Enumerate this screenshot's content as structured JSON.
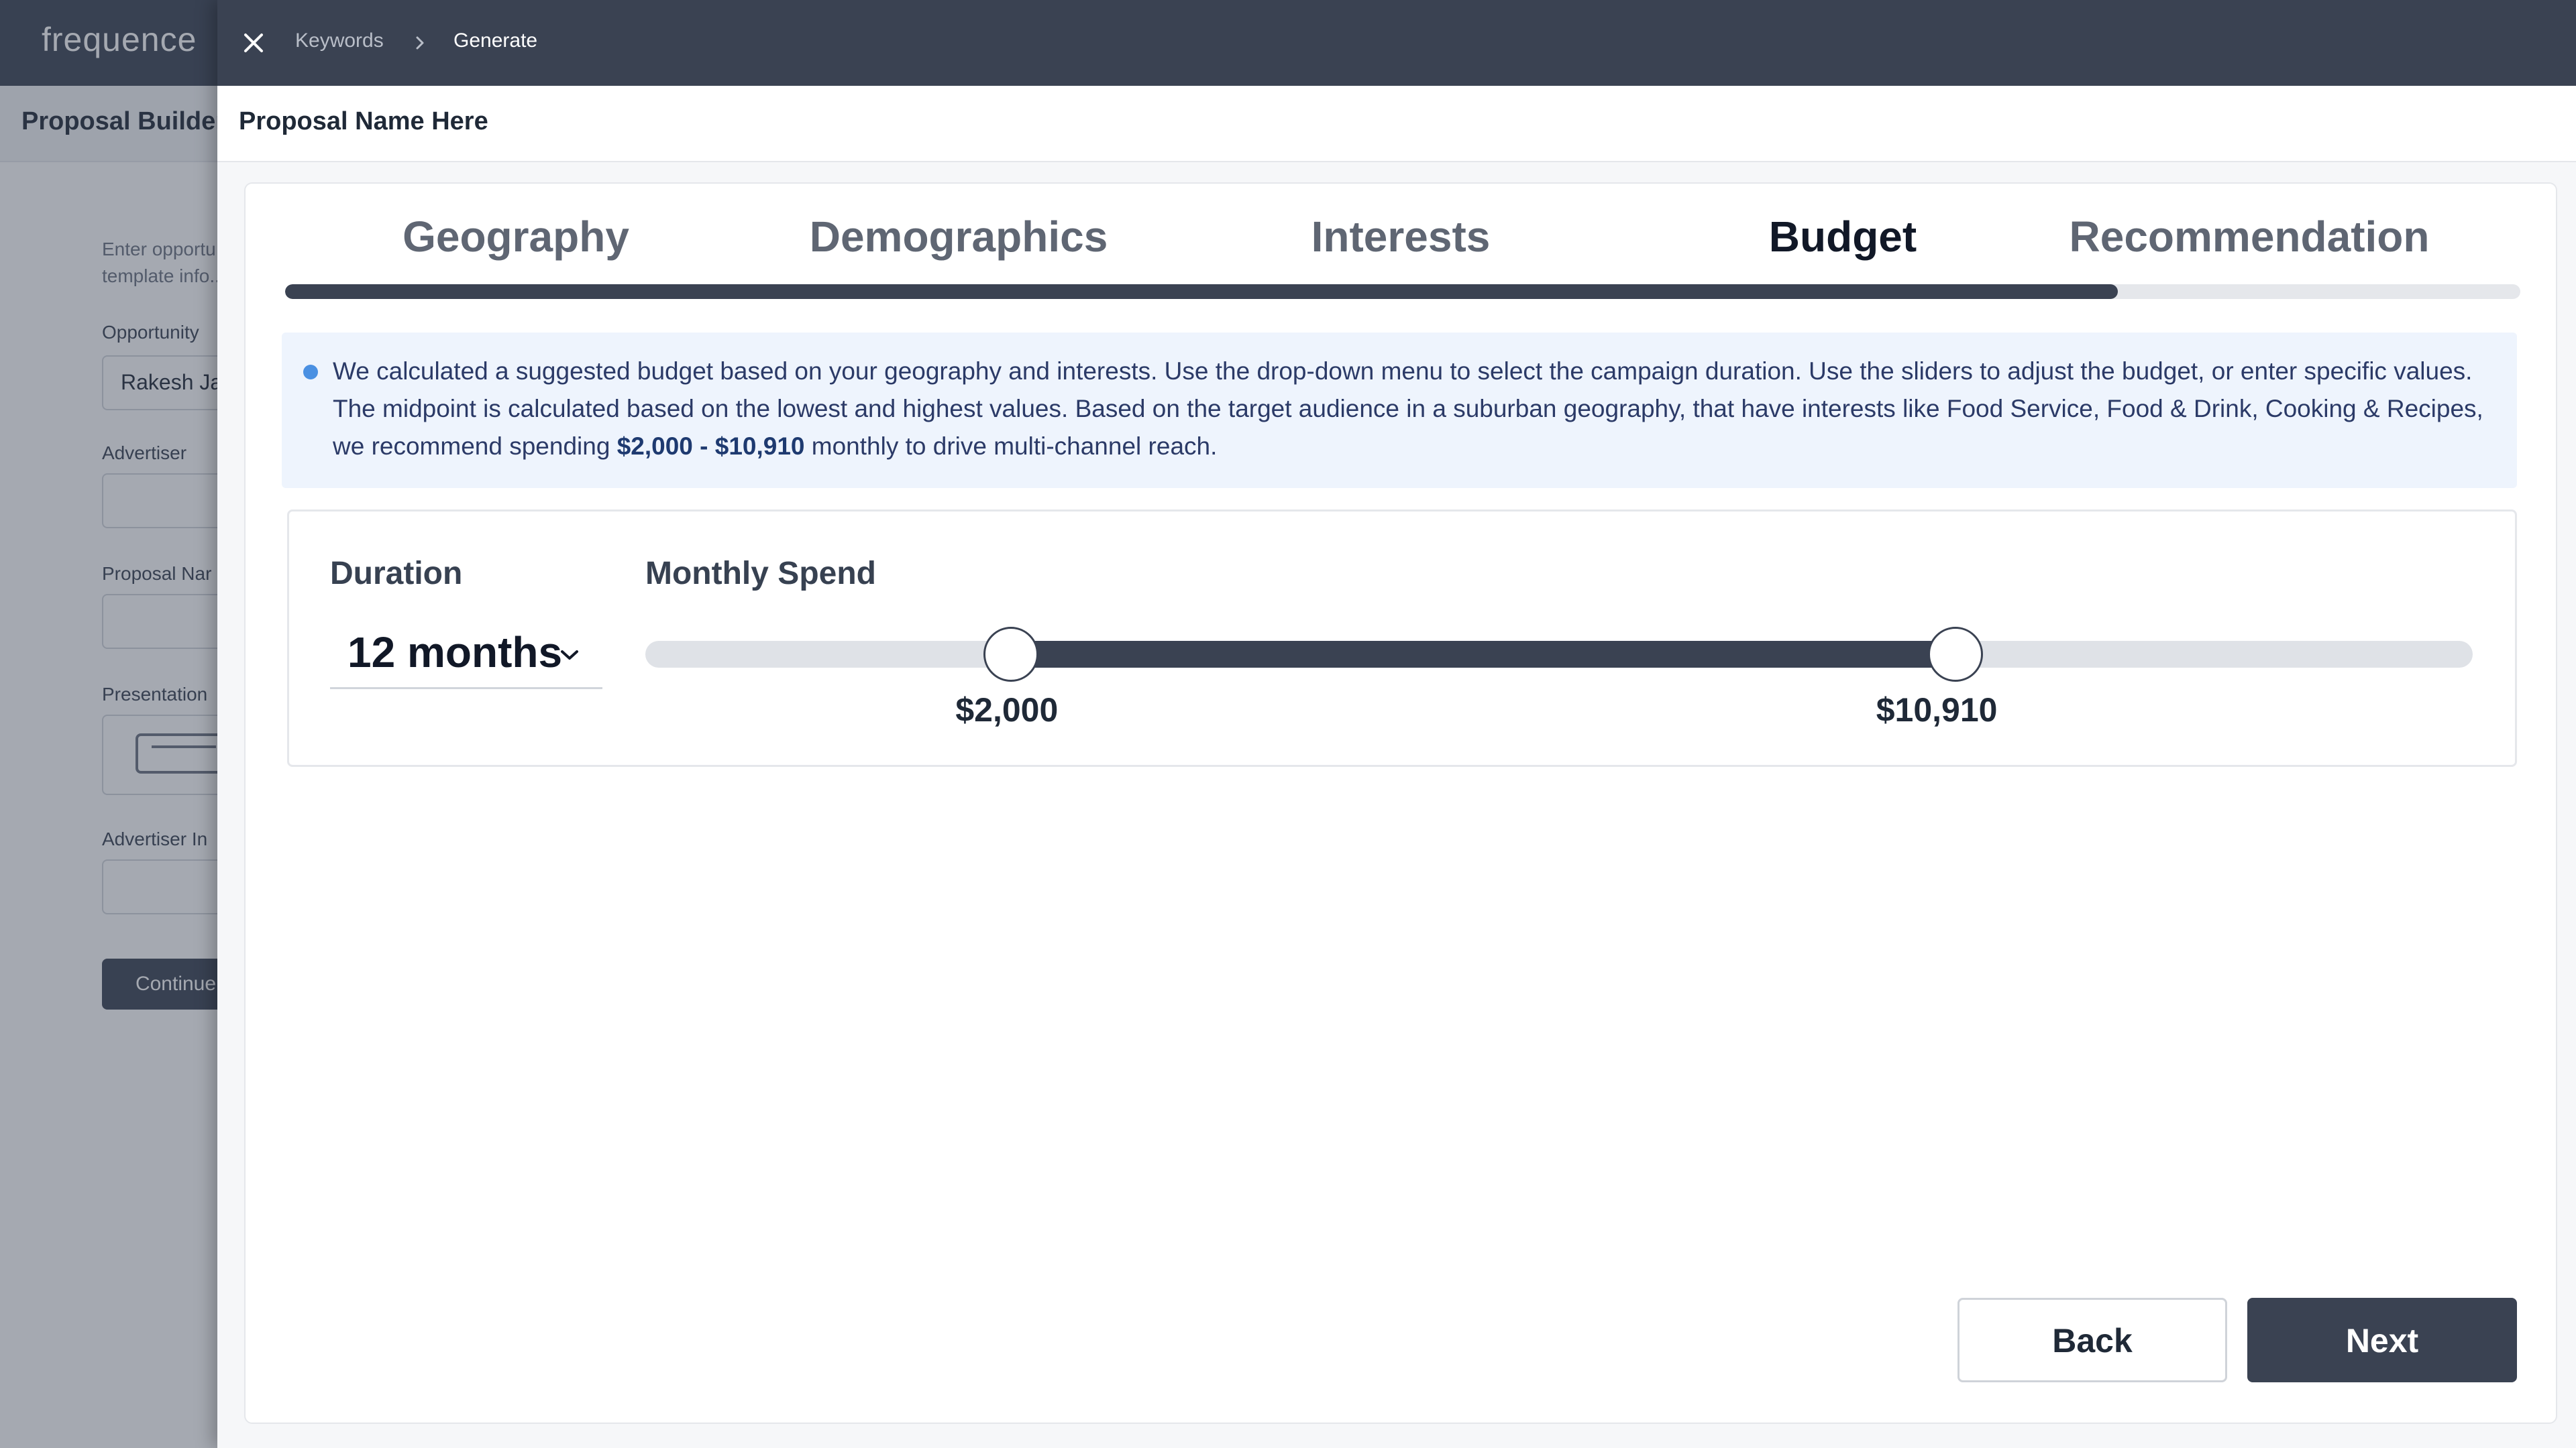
{
  "background_app": {
    "logo": "frequence",
    "title": "Proposal Builder",
    "helper_text": "Enter opportu... template info...",
    "fields": [
      {
        "label": "Opportunity",
        "value": "Rakesh Ja"
      },
      {
        "label": "Advertiser",
        "value": ""
      },
      {
        "label": "Proposal Nar",
        "value": ""
      },
      {
        "label": "Presentation",
        "value": ""
      },
      {
        "label": "Advertiser In",
        "value": ""
      }
    ],
    "continue_label": "Continue"
  },
  "header": {
    "close_icon": "close-icon",
    "breadcrumb": [
      "Keywords",
      "Generate"
    ],
    "proposal_name": "Proposal Name Here"
  },
  "steps": {
    "items": [
      "Geography",
      "Demographics",
      "Interests",
      "Budget",
      "Recommendation"
    ],
    "active": "Budget",
    "progress": 0.82
  },
  "info": {
    "text_before": "We calculated a suggested budget based on your geography and interests. Use the drop-down menu to select the campaign duration. Use the sliders to adjust the budget, or enter specific values. The midpoint is calculated based on the lowest and highest values. Based on the target audience in a suburban geography, that have interests like Food Service, Food & Drink, Cooking & Recipes, we recommend spending ",
    "highlight": "$2,000 - $10,910",
    "text_after": " monthly to drive multi-channel reach."
  },
  "budget": {
    "duration_label": "Duration",
    "duration_value": "12 months",
    "monthly_spend_label": "Monthly Spend",
    "slider": {
      "low": 2000,
      "high": 10910,
      "low_label": "$2,000",
      "high_label": "$10,910",
      "low_fraction": 0.2,
      "high_fraction": 0.717
    }
  },
  "footer": {
    "back_label": "Back",
    "next_label": "Next"
  },
  "colors": {
    "brand_dark": "#3a4252",
    "info_bg": "#eef4fd",
    "info_dot": "#4a90e2"
  }
}
